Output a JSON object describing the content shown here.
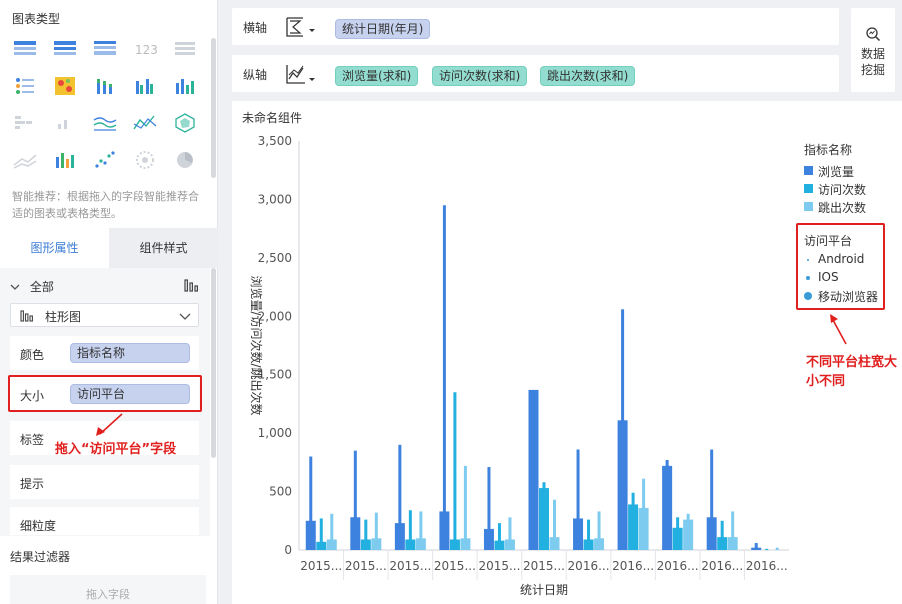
{
  "left_panel": {
    "chart_type_title": "图表类型",
    "chart_type_icons": [
      "detail-table-icon",
      "grouped-table-icon",
      "cross-table-icon",
      "kpi-number-icon",
      "gray-table-icon",
      "multi-series-table-icon",
      "heatmap-icon",
      "stacked-bar-icon",
      "grouped-bar-icon",
      "bar-chart-icon",
      "dot-map-icon",
      "small-bar-icon",
      "line-chart-icon",
      "area-line-icon",
      "radar-icon",
      "gray-line-icon",
      "colored-bar-icon",
      "scatter-icon",
      "bubble-icon",
      "pie-icon"
    ],
    "hint": "智能推荐：根据拖入的字段智能推荐合适的图表或表格类型。",
    "tabs": {
      "graph": "图形属性",
      "style": "组件样式"
    },
    "all_label": "全部",
    "chart_kind": "柱形图",
    "props": [
      {
        "key": "颜色",
        "value": "指标名称"
      },
      {
        "key": "大小",
        "value": "访问平台"
      },
      {
        "key": "标签",
        "value": ""
      },
      {
        "key": "提示",
        "value": ""
      },
      {
        "key": "细粒度",
        "value": ""
      }
    ],
    "annotation": "拖入“访问平台”字段",
    "filter_title": "结果过滤器",
    "drop_placeholder": "拖入字段"
  },
  "axis": {
    "x_label": "横轴",
    "x_fields": [
      "统计日期(年月)"
    ],
    "y_label": "纵轴",
    "y_fields": [
      "浏览量(求和)",
      "访问次数(求和)",
      "跳出次数(求和)"
    ]
  },
  "mining": {
    "line1": "数据",
    "line2": "挖掘"
  },
  "component": {
    "title": "未命名组件",
    "legend_title1": "指标名称",
    "legend_items1": [
      "浏览量",
      "访问次数",
      "跳出次数"
    ],
    "legend_title2": "访问平台",
    "legend_items2": [
      "Android",
      "IOS",
      "移动浏览器"
    ],
    "annotation": "不同平台柱宽大小不同"
  },
  "colors": {
    "pv": "#3d82de",
    "visits": "#22b0e0",
    "bounce": "#7ecbf0",
    "accent": "#3a7bd5",
    "red": "#e0201f"
  },
  "chart_data": {
    "type": "bar",
    "xlabel": "统计日期",
    "ylabel": "浏览量/访问次数/跳出次数",
    "ylim": [
      0,
      3500
    ],
    "yticks": [
      0,
      500,
      1000,
      1500,
      2000,
      2500,
      3000,
      3500
    ],
    "categories": [
      "2015...",
      "2015...",
      "2015...",
      "2015...",
      "2015...",
      "2015...",
      "2016...",
      "2016...",
      "2016...",
      "2016...",
      "2016..."
    ],
    "series": [
      {
        "name": "浏览量",
        "color": "#3d82de",
        "values": [
          [
            800,
            250,
            0
          ],
          [
            850,
            280,
            0
          ],
          [
            900,
            230,
            0
          ],
          [
            2950,
            330,
            0
          ],
          [
            710,
            180,
            0
          ],
          [
            1330,
            1370,
            330
          ],
          [
            860,
            270,
            0
          ],
          [
            2060,
            1110,
            580
          ],
          [
            770,
            720,
            640
          ],
          [
            860,
            280,
            0
          ],
          [
            60,
            20,
            0
          ]
        ]
      },
      {
        "name": "访问次数",
        "color": "#22b0e0",
        "values": [
          [
            270,
            70,
            0
          ],
          [
            260,
            90,
            0
          ],
          [
            340,
            90,
            0
          ],
          [
            1350,
            90,
            0
          ],
          [
            230,
            80,
            0
          ],
          [
            580,
            530,
            100
          ],
          [
            260,
            90,
            0
          ],
          [
            490,
            390,
            120
          ],
          [
            280,
            190,
            60
          ],
          [
            250,
            110,
            0
          ],
          [
            10,
            0,
            0
          ]
        ]
      },
      {
        "name": "跳出次数",
        "color": "#7ecbf0",
        "values": [
          [
            310,
            90,
            0
          ],
          [
            320,
            100,
            0
          ],
          [
            330,
            100,
            0
          ],
          [
            720,
            100,
            0
          ],
          [
            280,
            90,
            0
          ],
          [
            430,
            110,
            0
          ],
          [
            330,
            100,
            0
          ],
          [
            610,
            360,
            170
          ],
          [
            310,
            260,
            90
          ],
          [
            330,
            110,
            0
          ],
          [
            20,
            0,
            0
          ]
        ]
      }
    ]
  }
}
